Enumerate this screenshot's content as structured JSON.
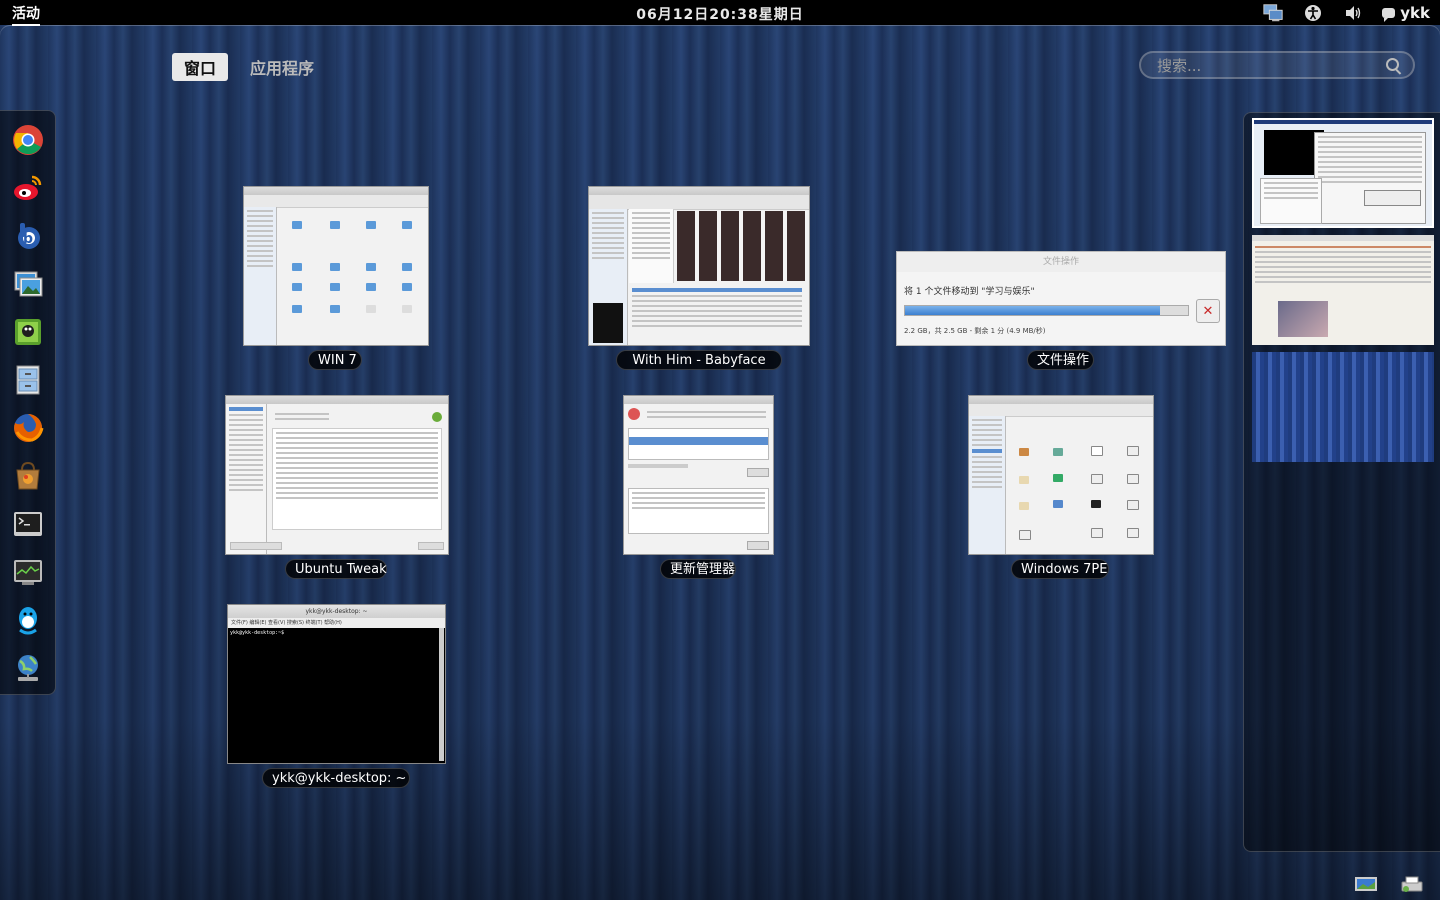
{
  "topbar": {
    "activities": "活动",
    "clock": "06月12日20:38星期日",
    "user": "ykk",
    "tray_icons": [
      "network-icon",
      "accessibility-icon",
      "volume-icon",
      "chat-status-icon"
    ]
  },
  "view_tabs": [
    {
      "label": "窗口",
      "active": true
    },
    {
      "label": "应用程序",
      "active": false
    }
  ],
  "search": {
    "placeholder": "搜索..."
  },
  "dash": {
    "apps": [
      "chrome-icon",
      "weibo-icon",
      "baidu-icon",
      "image-viewer-icon",
      "tux-game-icon",
      "file-manager-icon",
      "firefox-icon",
      "software-center-icon",
      "terminal-icon",
      "system-monitor-icon",
      "qq-icon",
      "network-globe-icon"
    ]
  },
  "windows": [
    {
      "caption": "WIN 7"
    },
    {
      "caption": "With Him - Babyface"
    },
    {
      "caption": "文件操作",
      "dialog": {
        "title": "文件操作",
        "message": "将 1 个文件移动到 \"学习与娱乐\"",
        "status": "2.2 GB，共 2.5 GB - 剩余 1 分 (4.9 MB/秒)",
        "progress": 0.9
      }
    },
    {
      "caption": "Ubuntu Tweak"
    },
    {
      "caption": "更新管理器"
    },
    {
      "caption": "Windows 7PE"
    },
    {
      "caption": "ykk@ykk-desktop: ~",
      "terminal": {
        "title": "ykk@ykk-desktop: ~",
        "menu": "文件(F)  编辑(E)  查看(V)  搜索(S)  终端(T)  帮助(H)",
        "prompt": "ykk@ykk-desktop:~$"
      }
    }
  ],
  "workspaces": [
    {
      "active": true
    },
    {
      "active": false
    },
    {
      "active": false
    }
  ],
  "colors": {
    "topbar": "#000000",
    "background": "#1d3258",
    "progress": "#4a90d9"
  }
}
